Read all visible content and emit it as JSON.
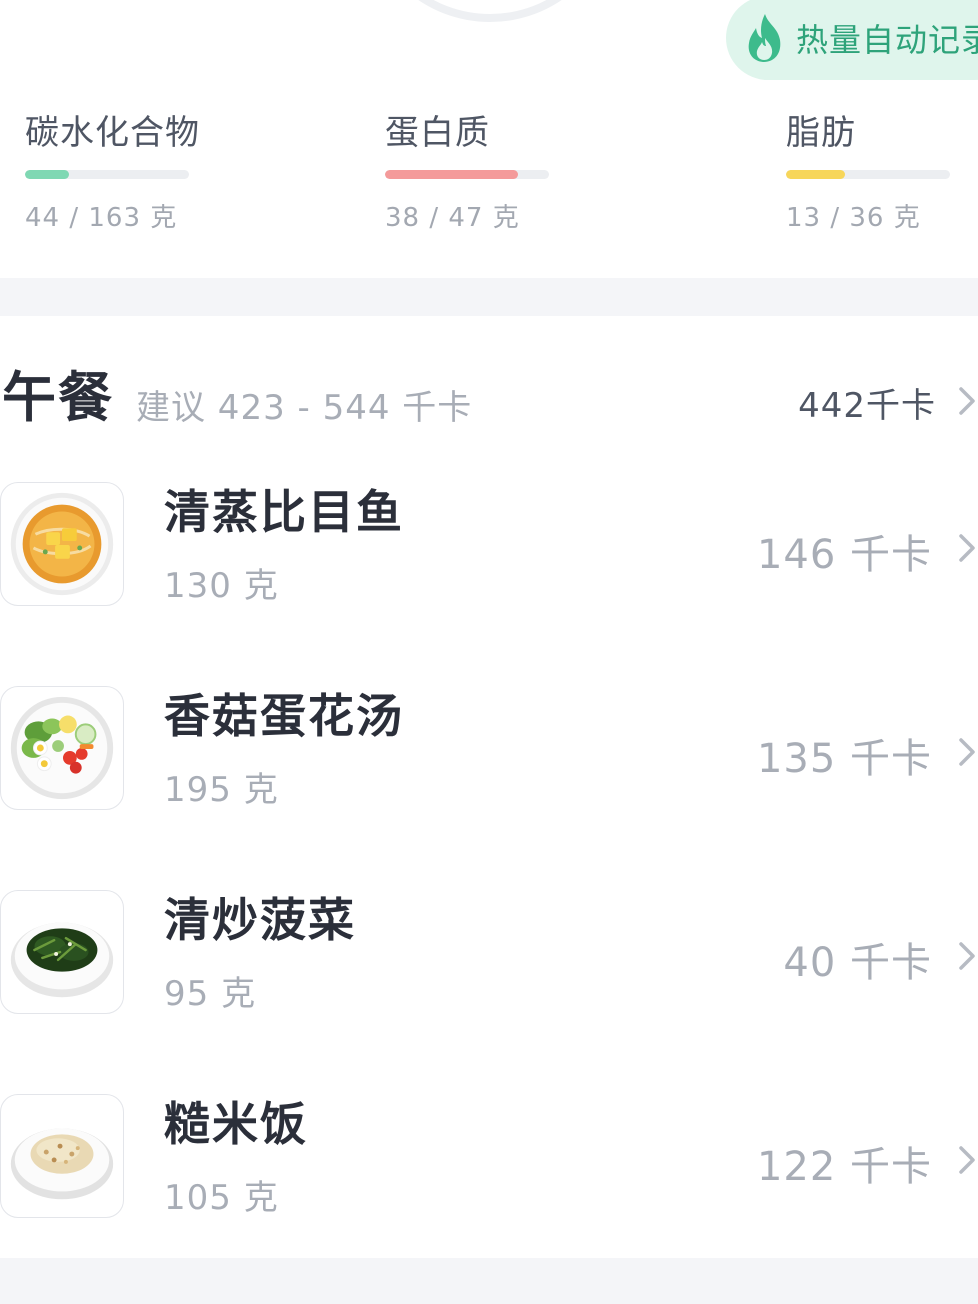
{
  "auto_record": {
    "label": "热量自动记录",
    "accent": "#2ea37a",
    "icon": "flame-icon"
  },
  "macros": [
    {
      "name": "碳水化合物",
      "value": "44 / 163 克",
      "current": 44,
      "target": 163,
      "color": "#7fd8b3"
    },
    {
      "name": "蛋白质",
      "value": "38 / 47 克",
      "current": 38,
      "target": 47,
      "color": "#f49a9a"
    },
    {
      "name": "脂肪",
      "value": "13 / 36 克",
      "current": 13,
      "target": 36,
      "color": "#f7d65a"
    }
  ],
  "meal": {
    "title": "午餐",
    "suggestion": "建议 423 - 544 千卡",
    "total": "442千卡",
    "foods": [
      {
        "name": "清蒸比目鱼",
        "weight": "130 克",
        "kcal": "146 千卡",
        "icon": "fish-soup-icon"
      },
      {
        "name": "香菇蛋花汤",
        "weight": "195 克",
        "kcal": "135 千卡",
        "icon": "salad-plate-icon"
      },
      {
        "name": "清炒菠菜",
        "weight": "95 克",
        "kcal": "40 千卡",
        "icon": "spinach-plate-icon"
      },
      {
        "name": "糙米饭",
        "weight": "105 克",
        "kcal": "122 千卡",
        "icon": "rice-plate-icon"
      }
    ]
  }
}
